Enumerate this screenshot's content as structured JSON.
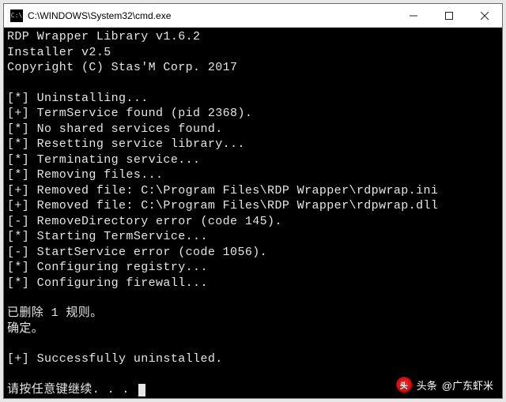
{
  "window": {
    "title": "C:\\WINDOWS\\System32\\cmd.exe",
    "icon_label": "C:\\"
  },
  "terminal": {
    "lines": [
      "RDP Wrapper Library v1.6.2",
      "Installer v2.5",
      "Copyright (C) Stas'M Corp. 2017",
      "",
      "[*] Uninstalling...",
      "[+] TermService found (pid 2368).",
      "[*] No shared services found.",
      "[*] Resetting service library...",
      "[*] Terminating service...",
      "[*] Removing files...",
      "[+] Removed file: C:\\Program Files\\RDP Wrapper\\rdpwrap.ini",
      "[+] Removed file: C:\\Program Files\\RDP Wrapper\\rdpwrap.dll",
      "[-] RemoveDirectory error (code 145).",
      "[*] Starting TermService...",
      "[-] StartService error (code 1056).",
      "[*] Configuring registry...",
      "[*] Configuring firewall...",
      "",
      "已删除 1 规则。",
      "确定。",
      "",
      "[+] Successfully uninstalled.",
      ""
    ],
    "prompt": "请按任意键继续. . . "
  },
  "watermark": {
    "prefix": "头条",
    "author": "@广东虾米",
    "logo_char": "头"
  }
}
